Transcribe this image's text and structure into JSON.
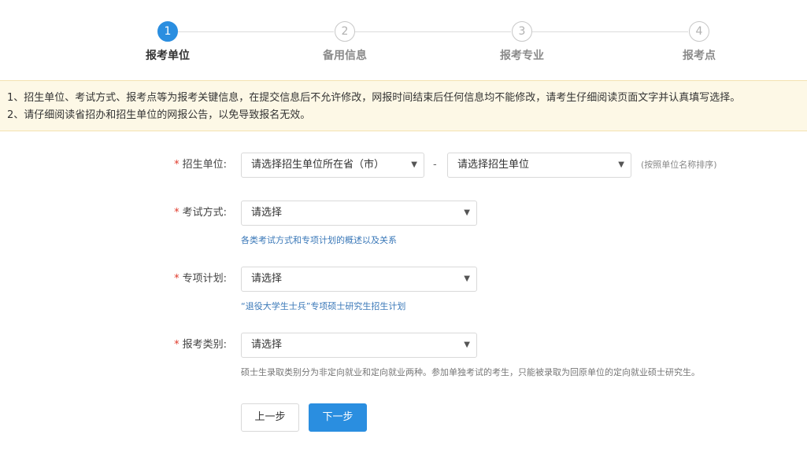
{
  "steps": [
    {
      "number": "1",
      "label": "报考单位"
    },
    {
      "number": "2",
      "label": "备用信息"
    },
    {
      "number": "3",
      "label": "报考专业"
    },
    {
      "number": "4",
      "label": "报考点"
    }
  ],
  "notice": {
    "line1": "1、招生单位、考试方式、报考点等为报考关键信息，在提交信息后不允许修改，网报时间结束后任何信息均不能修改，请考生仔细阅读页面文字并认真填写选择。",
    "line2": "2、请仔细阅读省招办和招生单位的网报公告，以免导致报名无效。"
  },
  "form": {
    "required_mark": "*",
    "unit": {
      "label": "招生单位:",
      "province_select": "请选择招生单位所在省（市）",
      "separator": "-",
      "unit_select": "请选择招生单位",
      "hint": "(按照单位名称排序)"
    },
    "exam_method": {
      "label": "考试方式:",
      "select": "请选择",
      "hint": "各类考试方式和专项计划的概述以及关系"
    },
    "special_plan": {
      "label": "专项计划:",
      "select": "请选择",
      "hint": "“退役大学生士兵”专项硕士研究生招生计划"
    },
    "category": {
      "label": "报考类别:",
      "select": "请选择",
      "hint": "硕士生录取类别分为非定向就业和定向就业两种。参加单独考试的考生，只能被录取为回原单位的定向就业硕士研究生。"
    }
  },
  "buttons": {
    "prev": "上一步",
    "next": "下一步"
  },
  "icons": {
    "caret": "▼"
  },
  "colors": {
    "accent": "#2a8ee0",
    "required": "#e0392a",
    "notice_bg": "#fdf8e6",
    "link": "#3a78b8"
  }
}
